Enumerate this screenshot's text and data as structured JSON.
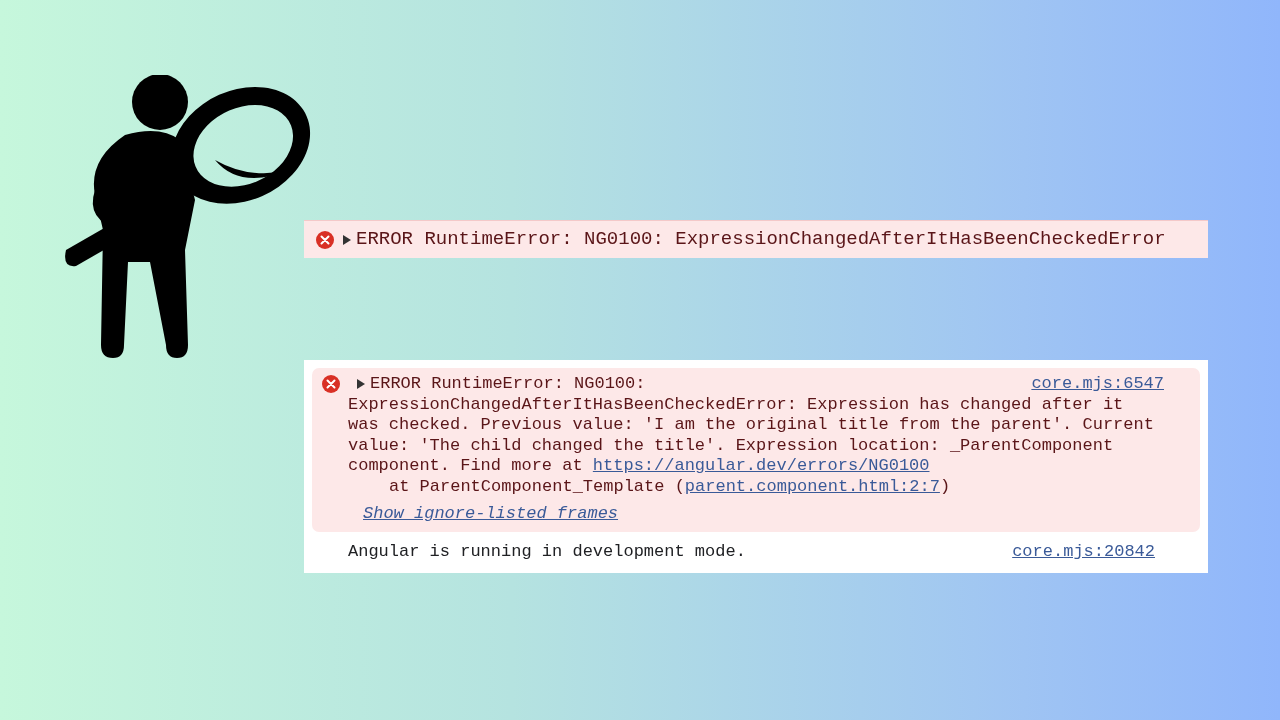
{
  "collapsed_error": {
    "kind": "error",
    "expanded": false,
    "text": "ERROR RuntimeError: NG0100: ExpressionChangedAfterItHasBeenCheckedError"
  },
  "console": [
    {
      "kind": "error",
      "expanded": false,
      "source": "core.mjs:6547",
      "title": "ERROR RuntimeError: NG0100:",
      "message": "ExpressionChangedAfterItHasBeenCheckedError: Expression has changed after it was checked. Previous value: 'I am the original title from the parent'. Current value: 'The child changed the title'. Expression location: _ParentComponent component. Find more at",
      "message_link": "https://angular.dev/errors/NG0100",
      "stack": [
        {
          "prefix": "at ParentComponent_Template (",
          "link": "parent.component.html:2:7",
          "suffix": ")"
        }
      ],
      "ignore_link": "Show ignore-listed frames"
    },
    {
      "kind": "info",
      "source": "core.mjs:20842",
      "message": "Angular is running in development mode."
    }
  ]
}
